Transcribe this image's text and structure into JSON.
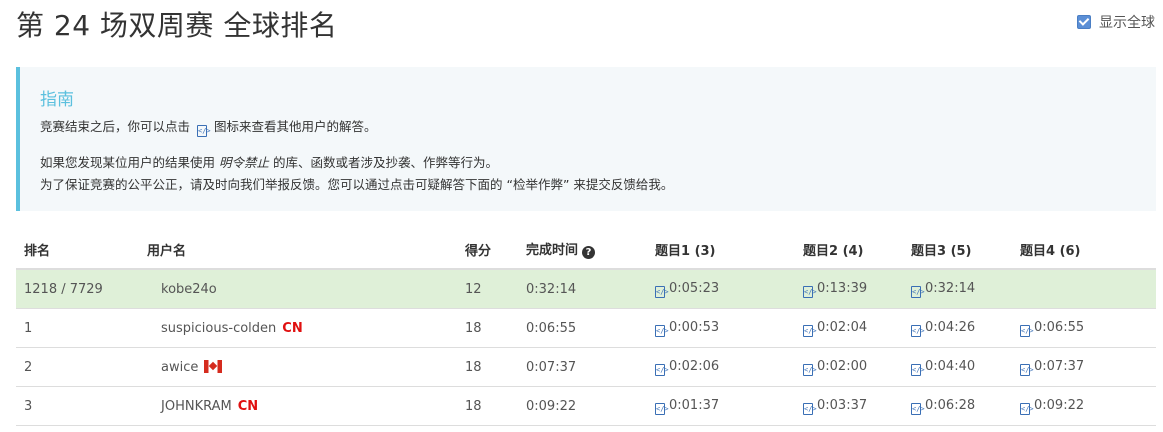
{
  "page": {
    "title": "第 24 场双周赛 全球排名",
    "toggle_label": "显示全球"
  },
  "guide": {
    "heading": "指南",
    "line1_pre": "竞赛结束之后，你可以点击",
    "line1_post": "图标来查看其他用户的解答。",
    "line2_pre": "如果您发现某位用户的结果使用",
    "line2_em": "明令禁止",
    "line2_post": "的库、函数或者涉及抄袭、作弊等行为。",
    "line3": "为了保证竞赛的公平公正，请及时向我们举报反馈。您可以通过点击可疑解答下面的 “检举作弊” 来提交反馈给我。"
  },
  "table": {
    "headers": {
      "rank": "排名",
      "user": "用户名",
      "score": "得分",
      "time": "完成时间",
      "q1": "题目1 (3)",
      "q2": "题目2 (4)",
      "q3": "题目3 (5)",
      "q4": "题目4 (6)"
    },
    "help_glyph": "?",
    "rows": [
      {
        "rank": "1218 / 7729",
        "user": "kobe24o",
        "region": "",
        "score": "12",
        "time": "0:32:14",
        "q1": "0:05:23",
        "q2": "0:13:39",
        "q3": "0:32:14",
        "q4": ""
      },
      {
        "rank": "1",
        "user": "suspicious-colden",
        "region": "CN",
        "score": "18",
        "time": "0:06:55",
        "q1": "0:00:53",
        "q2": "0:02:04",
        "q3": "0:04:26",
        "q4": "0:06:55"
      },
      {
        "rank": "2",
        "user": "awice",
        "region": "",
        "score": "18",
        "time": "0:07:37",
        "q1": "0:02:06",
        "q2": "0:02:00",
        "q3": "0:04:40",
        "q4": "0:07:37"
      },
      {
        "rank": "3",
        "user": "JOHNKRAM",
        "region": "CN",
        "score": "18",
        "time": "0:09:22",
        "q1": "0:01:37",
        "q2": "0:03:37",
        "q3": "0:06:28",
        "q4": "0:09:22"
      }
    ]
  },
  "icons": {
    "code_icon": "code-icon",
    "flag_row2": "canada-flag-icon"
  },
  "colors": {
    "guide_accent": "#5bc0de",
    "my_row_bg": "#dff0d8",
    "cn_red": "#e01010"
  }
}
